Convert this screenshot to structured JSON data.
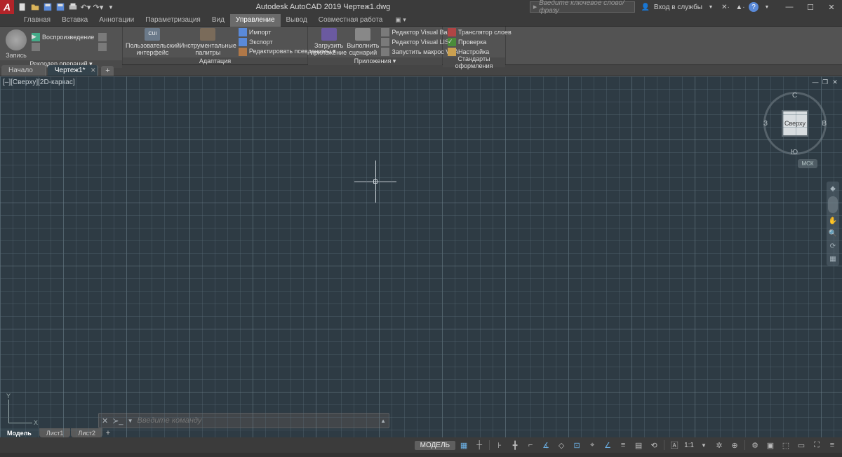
{
  "app": {
    "title": "Autodesk AutoCAD 2019    Чертеж1.dwg"
  },
  "search": {
    "placeholder": "Введите ключевое слово/фразу"
  },
  "signin": "Вход в службы",
  "menu": {
    "items": [
      "Главная",
      "Вставка",
      "Аннотации",
      "Параметризация",
      "Вид",
      "Управление",
      "Вывод",
      "Совместная работа"
    ],
    "active": 5
  },
  "ribbon": {
    "recorder": {
      "record": "Запись",
      "playback": "Воспроизведение",
      "title": "Рекордер операций ▾"
    },
    "adaptation": {
      "cui": "Пользовательский интерфейс",
      "palettes": "Инструментальные палитры",
      "import": "Импорт",
      "export": "Экспорт",
      "editalias": "Редактировать псевдонимы ▾",
      "title": "Адаптация"
    },
    "apps": {
      "load": "Загрузить приложение",
      "script": "Выполнить сценарий",
      "vbe": "Редактор Visual Basic",
      "vle": "Редактор Visual LISP",
      "macro": "Запустить макрос VBA",
      "title": "Приложения ▾"
    },
    "standards": {
      "trans": "Транслятор слоев",
      "check": "Проверка",
      "configure": "Настройка",
      "title": "Стандарты оформления"
    }
  },
  "tabs": {
    "start": "Начало",
    "current": "Чертеж1*"
  },
  "viewport": {
    "label": "[–][Сверху][2D-каркас]"
  },
  "viewcube": {
    "face": "Сверху",
    "n": "С",
    "s": "Ю",
    "e": "В",
    "w": "З",
    "wcs": "МСК"
  },
  "ucs": {
    "x": "X",
    "y": "Y"
  },
  "cmd": {
    "placeholder": "Введите команду",
    "close": "✕"
  },
  "layouts": {
    "model": "Модель",
    "l1": "Лист1",
    "l2": "Лист2"
  },
  "status": {
    "model": "МОДЕЛЬ",
    "scale": "1:1"
  }
}
